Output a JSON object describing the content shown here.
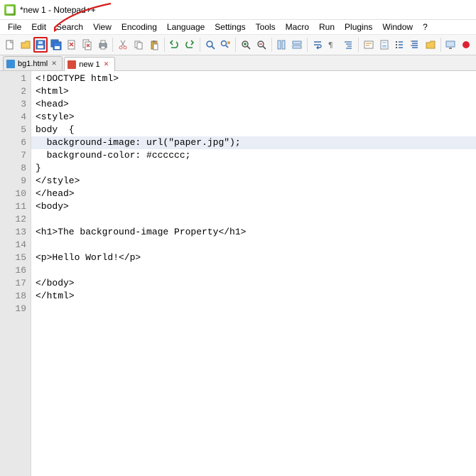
{
  "title": "*new 1 - Notepad++",
  "menu": [
    "File",
    "Edit",
    "Search",
    "View",
    "Encoding",
    "Language",
    "Settings",
    "Tools",
    "Macro",
    "Run",
    "Plugins",
    "Window",
    "?"
  ],
  "toolbar_icons": [
    "new-file-icon",
    "open-file-icon",
    "save-icon",
    "save-all-icon",
    "close-icon",
    "close-all-icon",
    "print-icon",
    "|",
    "cut-icon",
    "copy-icon",
    "paste-icon",
    "|",
    "undo-icon",
    "redo-icon",
    "|",
    "find-icon",
    "replace-icon",
    "|",
    "zoom-in-icon",
    "zoom-out-icon",
    "|",
    "sync-v-icon",
    "sync-h-icon",
    "|",
    "wordwrap-icon",
    "show-all-icon",
    "indent-guide-icon",
    "|",
    "lang-pref-icon",
    "doc-map-icon",
    "doc-list-icon",
    "func-list-icon",
    "folder-icon",
    "|",
    "monitor-icon",
    "record-icon"
  ],
  "tabs": [
    {
      "label": "bg1.html",
      "active": false,
      "modified": false,
      "icon_color": "#3b8fd6"
    },
    {
      "label": "new 1",
      "active": true,
      "modified": true,
      "icon_color": "#d64b3b"
    }
  ],
  "code_lines": [
    "<!DOCTYPE html>",
    "<html>",
    "<head>",
    "<style>",
    "body  {",
    "  background-image: url(\"paper.jpg\");",
    "  background-color: #cccccc;",
    "}",
    "</style>",
    "</head>",
    "<body>",
    "",
    "<h1>The background-image Property</h1>",
    "",
    "<p>Hello World!</p>",
    "",
    "</body>",
    "</html>",
    ""
  ],
  "highlighted_line_index": 5
}
